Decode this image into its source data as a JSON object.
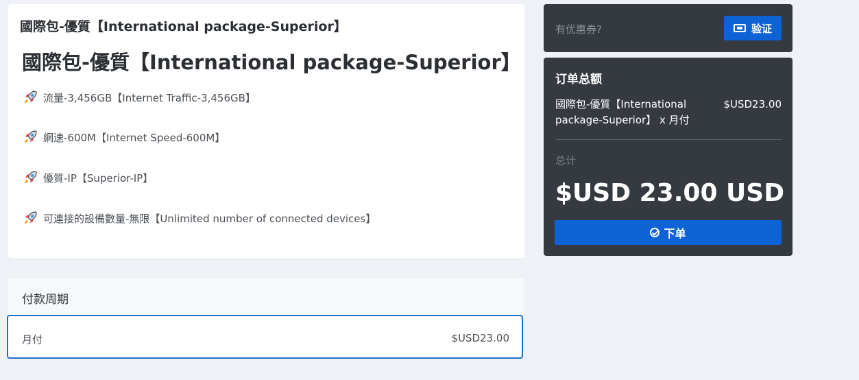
{
  "product": {
    "header": "國際包-優質【International package-Superior】",
    "title": "國際包-優質【International package-Superior】",
    "features": [
      "流量-3,456GB【Internet Traffic-3,456GB】",
      "網速-600M【Internet Speed-600M】",
      "優質-IP【Superior-IP】",
      "可連接的設備數量-無限【Unlimited number of connected devices】"
    ],
    "feature_icon": "rocket-icon"
  },
  "billing": {
    "heading": "付款周期",
    "option_name": "月付",
    "option_price": "$USD23.00",
    "accent": "#1c6fc9"
  },
  "coupon": {
    "placeholder": "有优惠券?",
    "verify_label": "验证",
    "icon": "ticket-icon"
  },
  "summary": {
    "title": "订单总额",
    "item": "國際包-優質【International package-Superior】 x 月付",
    "item_price": "$USD23.00",
    "total_label": "总计",
    "total": "$USD 23.00 USD",
    "order_label": "下单",
    "order_icon": "check-circle-icon",
    "button_color": "#0d63d6",
    "panel_color": "#343a40"
  }
}
